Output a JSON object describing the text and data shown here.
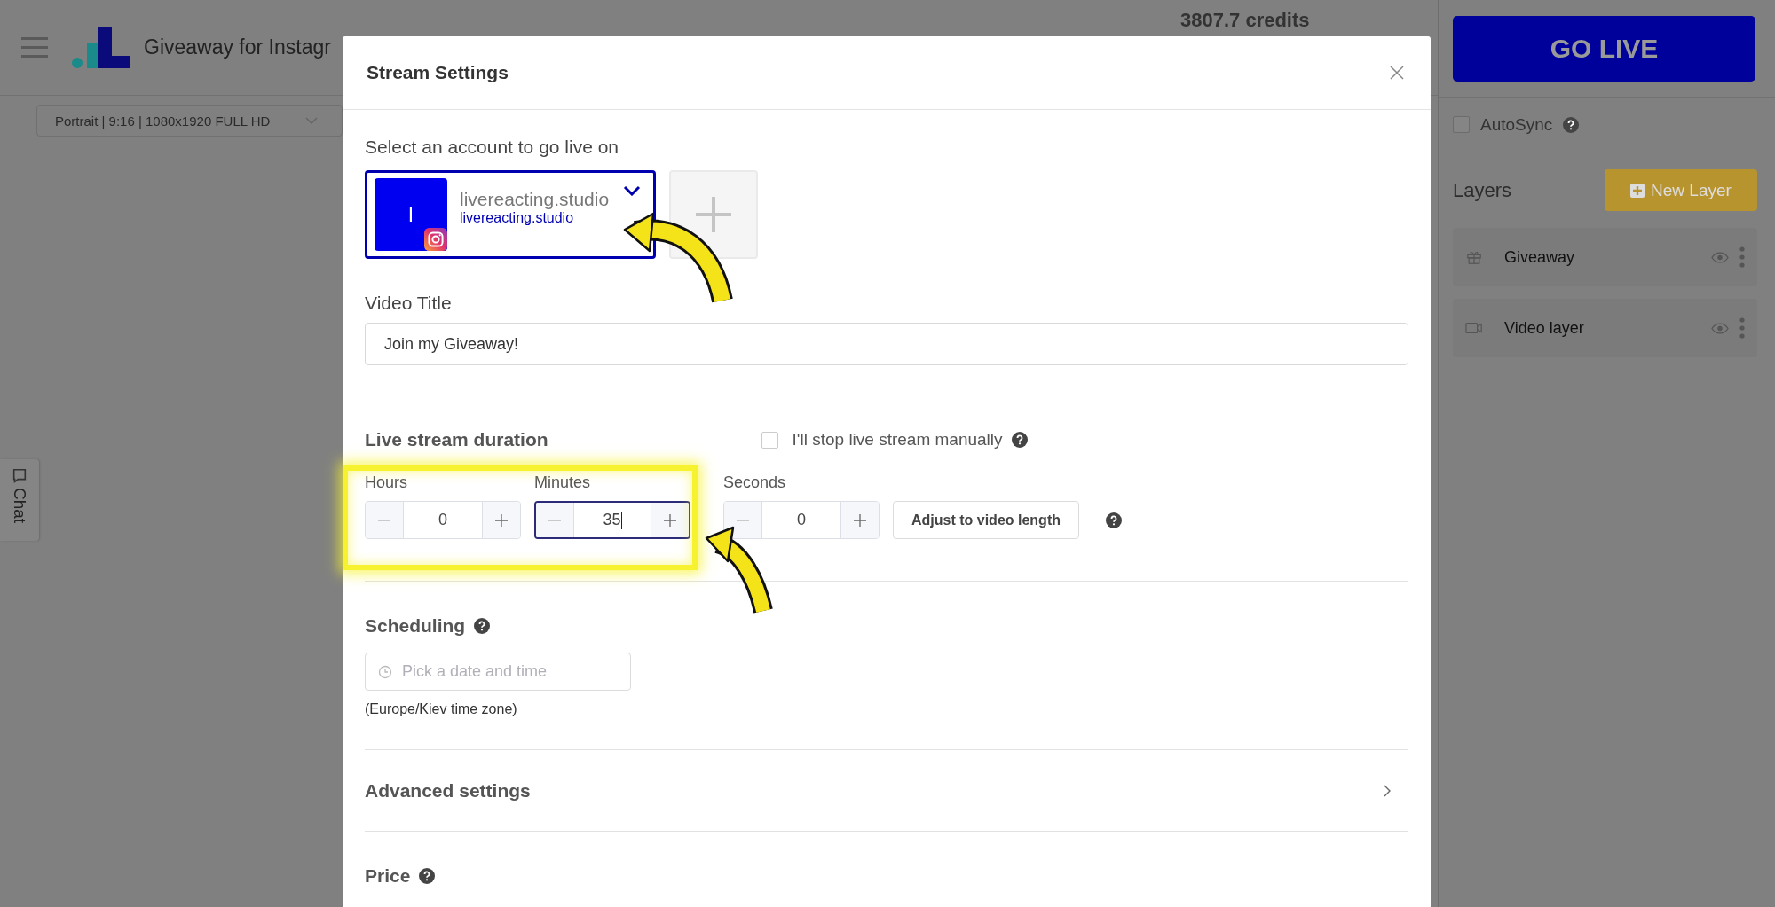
{
  "app": {
    "title": "Giveaway for Instagr",
    "credits": "3807.7 credits",
    "format": "Portrait | 9:16 | 1080x1920 FULL HD",
    "chat_tab": "Chat"
  },
  "sidebar": {
    "go_live": "GO LIVE",
    "autosync": {
      "label": "AutoSync",
      "checked": false
    },
    "layers_title": "Layers",
    "new_layer": "New Layer",
    "layers": [
      {
        "name": "Giveaway",
        "kind": "gift"
      },
      {
        "name": "Video layer",
        "kind": "video"
      }
    ]
  },
  "dialog": {
    "title": "Stream Settings",
    "account_label": "Select an account to go live on",
    "accounts": [
      {
        "avatar_letter": "l",
        "name": "livereacting.studio",
        "handle": "livereacting.studio",
        "selected": true
      }
    ],
    "video_title_label": "Video Title",
    "video_title": "Join my Giveaway!",
    "duration_title": "Live stream duration",
    "manual_stop": {
      "label": "I'll stop live stream manually",
      "checked": false
    },
    "duration_fields": [
      {
        "label": "Hours",
        "value": "0",
        "focused": false
      },
      {
        "label": "Minutes",
        "value": "35",
        "focused": true
      },
      {
        "label": "Seconds",
        "value": "0",
        "focused": false
      }
    ],
    "adjust_button": "Adjust to video length",
    "scheduling_title": "Scheduling",
    "schedule_placeholder": "Pick a date and time",
    "time_zone": "(Europe/Kiev time zone)",
    "advanced": "Advanced settings",
    "price": "Price"
  }
}
